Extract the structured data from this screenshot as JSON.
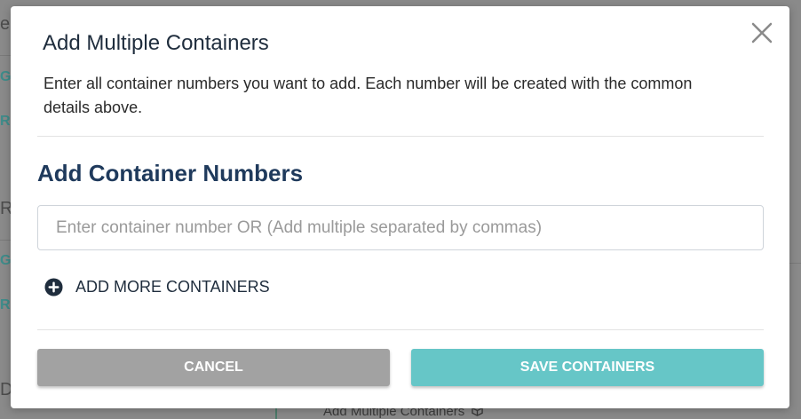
{
  "background": {
    "fragments": [
      "el",
      "G",
      "R",
      "R",
      "G",
      "R",
      "D"
    ],
    "bottom_text": "Add Multiple Containers"
  },
  "modal": {
    "title": "Add Multiple Containers",
    "description": "Enter all container numbers you want to add. Each number will be created with the common details above.",
    "section_title": "Add Container Numbers",
    "input": {
      "value": "",
      "placeholder": "Enter container number OR (Add multiple separated by commas)"
    },
    "add_more_label": "ADD MORE CONTAINERS",
    "cancel_label": "CANCEL",
    "save_label": "SAVE CONTAINERS"
  },
  "colors": {
    "title": "#1f2d3d",
    "section_title": "#1f3a5c",
    "cancel_button": "#a2a2a2",
    "save_button": "#66c6c7",
    "backdrop": "#8a8a8a"
  },
  "icons": {
    "close": "close-icon",
    "add": "plus-circle-icon",
    "bottom_link": "box-icon"
  }
}
